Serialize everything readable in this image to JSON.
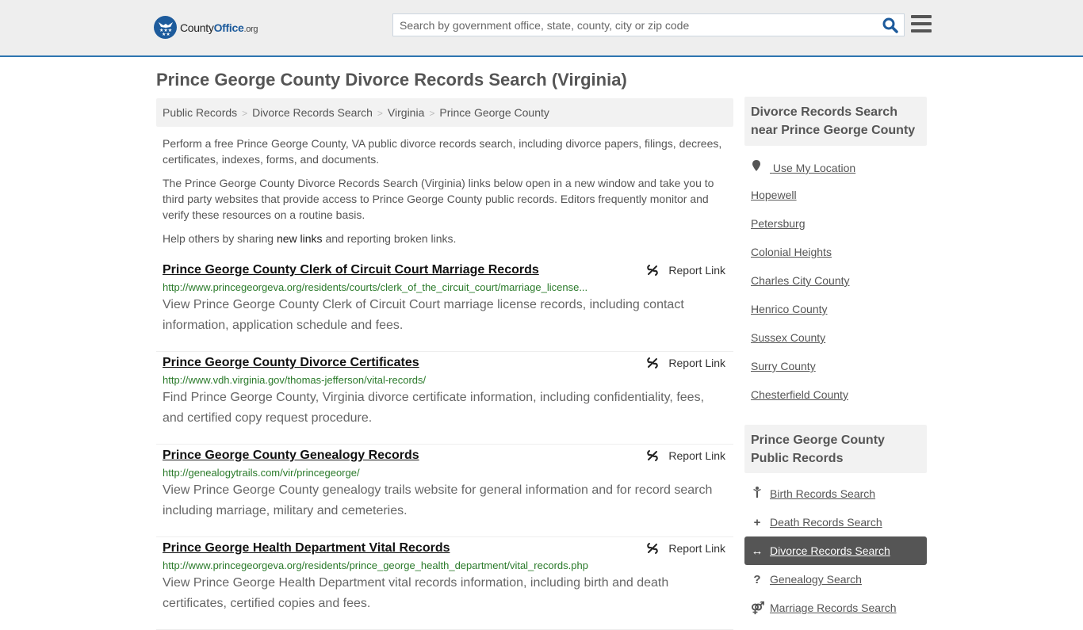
{
  "header": {
    "logo": {
      "name": "County",
      "name_accent": "Office",
      "tld": ".org",
      "icon": "eagle-stars-badge-icon"
    },
    "search_placeholder": "Search by government office, state, county, city or zip code",
    "search_value": "",
    "search_icon": "search-icon",
    "menu_icon": "hamburger-menu-icon",
    "brand_color": "#1d5b9c"
  },
  "page": {
    "title": "Prince George County Divorce Records Search (Virginia)"
  },
  "breadcrumb": [
    {
      "label": "Public Records"
    },
    {
      "label": "Divorce Records Search"
    },
    {
      "label": "Virginia"
    },
    {
      "label": "Prince George County"
    }
  ],
  "breadcrumb_separator": ">",
  "intro": {
    "p1": "Perform a free Prince George County, VA public divorce records search, including divorce papers, filings, decrees, certificates, indexes, forms, and documents.",
    "p2": "The Prince George County Divorce Records Search (Virginia) links below open in a new window and take you to third party websites that provide access to Prince George County public records. Editors frequently monitor and verify these resources on a routine basis.",
    "p3_before": "Help others by sharing ",
    "p3_link": "new links",
    "p3_after": " and reporting broken links."
  },
  "results": [
    {
      "title": "Prince George County Clerk of Circuit Court Marriage Records",
      "url": "http://www.princegeorgeva.org/residents/courts/clerk_of_the_circuit_court/marriage_license...",
      "description": "View Prince George County Clerk of Circuit Court marriage license records, including contact information, application schedule and fees.",
      "report_label": "Report Link"
    },
    {
      "title": "Prince George County Divorce Certificates",
      "url": "http://www.vdh.virginia.gov/thomas-jefferson/vital-records/",
      "description": "Find Prince George County, Virginia divorce certificate information, including confidentiality, fees, and certified copy request procedure.",
      "report_label": "Report Link"
    },
    {
      "title": "Prince George County Genealogy Records",
      "url": "http://genealogytrails.com/vir/princegeorge/",
      "description": "View Prince George County genealogy trails website for general information and for record search including marriage, military and cemeteries.",
      "report_label": "Report Link"
    },
    {
      "title": "Prince George Health Department Vital Records",
      "url": "http://www.princegeorgeva.org/residents/prince_george_health_department/vital_records.php",
      "description": "View Prince George Health Department vital records information, including birth and death certificates, certified copies and fees.",
      "report_label": "Report Link"
    }
  ],
  "sidebar": {
    "nearby_heading": "Divorce Records Search near Prince George County",
    "use_location": "Use My Location",
    "nearby": [
      "Hopewell",
      "Petersburg",
      "Colonial Heights",
      "Charles City County",
      "Henrico County",
      "Sussex County",
      "Surry County",
      "Chesterfield County"
    ],
    "records_heading": "Prince George County Public Records",
    "records": [
      {
        "label": "Birth Records Search",
        "icon": "child-icon",
        "glyph": "✝",
        "active": false
      },
      {
        "label": "Death Records Search",
        "icon": "plus-icon",
        "glyph": "+",
        "active": false
      },
      {
        "label": "Divorce Records Search",
        "icon": "arrows-horizontal-icon",
        "glyph": "↔",
        "active": true
      },
      {
        "label": "Genealogy Search",
        "icon": "question-icon",
        "glyph": "?",
        "active": false
      },
      {
        "label": "Marriage Records Search",
        "icon": "marriage-icon",
        "glyph": "⚤",
        "active": false
      }
    ]
  }
}
